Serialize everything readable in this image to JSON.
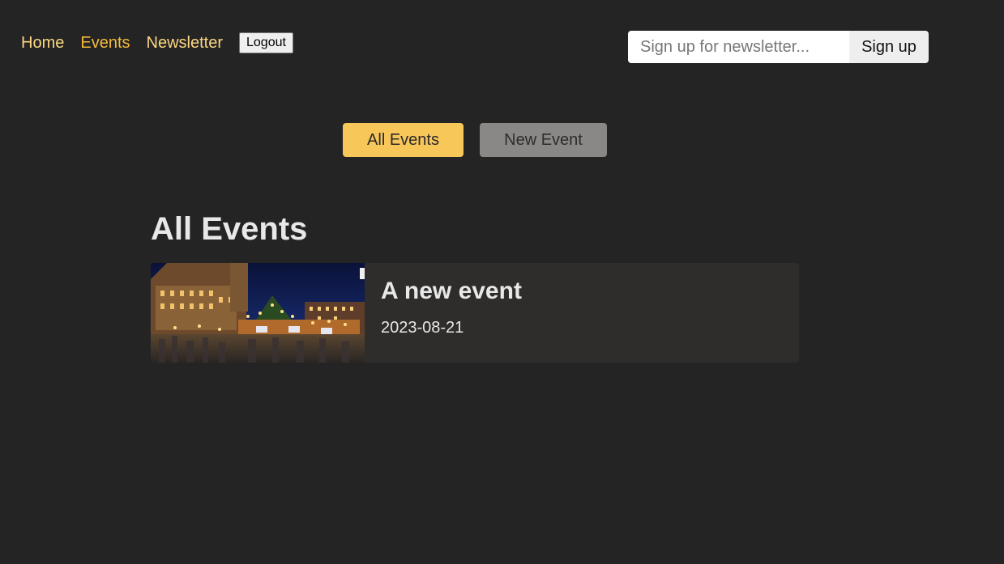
{
  "nav": {
    "home_label": "Home",
    "events_label": "Events",
    "newsletter_label": "Newsletter",
    "logout_label": "Logout"
  },
  "newsletter": {
    "placeholder": "Sign up for newsletter...",
    "button_label": "Sign up"
  },
  "subnav": {
    "all_events_label": "All Events",
    "new_event_label": "New Event"
  },
  "page": {
    "title": "All Events"
  },
  "events": [
    {
      "title": "A new event",
      "date": "2023-08-21",
      "image": "christmas-market-photo"
    }
  ],
  "colors": {
    "background": "#242424",
    "accent": "#f8c75a",
    "nav_link": "#fcd783",
    "nav_active": "#f5b93c",
    "card": "#2e2d2b",
    "secondary_button": "#8a8886"
  }
}
